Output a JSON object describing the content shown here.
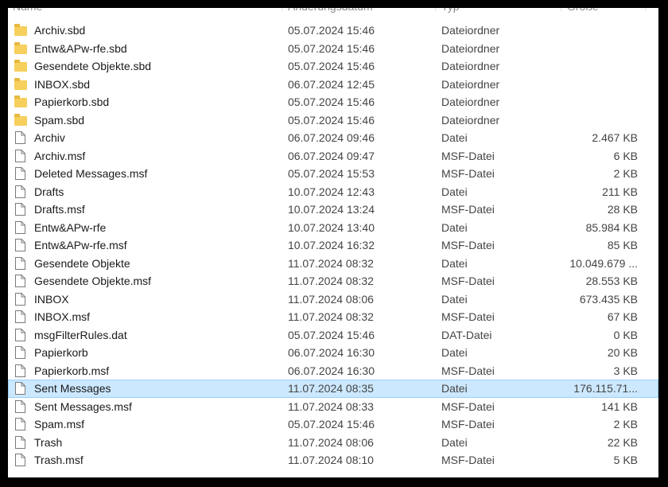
{
  "header": {
    "name": "Name",
    "date": "Änderungsdatum",
    "type": "Typ",
    "size": "Größe"
  },
  "files": [
    {
      "name": "Archiv.sbd",
      "date": "05.07.2024 15:46",
      "type": "Dateiordner",
      "size": "",
      "kind": "folder"
    },
    {
      "name": "Entw&APw-rfe.sbd",
      "date": "05.07.2024 15:46",
      "type": "Dateiordner",
      "size": "",
      "kind": "folder"
    },
    {
      "name": "Gesendete Objekte.sbd",
      "date": "05.07.2024 15:46",
      "type": "Dateiordner",
      "size": "",
      "kind": "folder"
    },
    {
      "name": "INBOX.sbd",
      "date": "06.07.2024 12:45",
      "type": "Dateiordner",
      "size": "",
      "kind": "folder"
    },
    {
      "name": "Papierkorb.sbd",
      "date": "05.07.2024 15:46",
      "type": "Dateiordner",
      "size": "",
      "kind": "folder"
    },
    {
      "name": "Spam.sbd",
      "date": "05.07.2024 15:46",
      "type": "Dateiordner",
      "size": "",
      "kind": "folder"
    },
    {
      "name": "Archiv",
      "date": "06.07.2024 09:46",
      "type": "Datei",
      "size": "2.467 KB",
      "kind": "file"
    },
    {
      "name": "Archiv.msf",
      "date": "06.07.2024 09:47",
      "type": "MSF-Datei",
      "size": "6 KB",
      "kind": "file"
    },
    {
      "name": "Deleted Messages.msf",
      "date": "05.07.2024 15:53",
      "type": "MSF-Datei",
      "size": "2 KB",
      "kind": "file"
    },
    {
      "name": "Drafts",
      "date": "10.07.2024 12:43",
      "type": "Datei",
      "size": "211 KB",
      "kind": "file"
    },
    {
      "name": "Drafts.msf",
      "date": "10.07.2024 13:24",
      "type": "MSF-Datei",
      "size": "28 KB",
      "kind": "file"
    },
    {
      "name": "Entw&APw-rfe",
      "date": "10.07.2024 13:40",
      "type": "Datei",
      "size": "85.984 KB",
      "kind": "file"
    },
    {
      "name": "Entw&APw-rfe.msf",
      "date": "10.07.2024 16:32",
      "type": "MSF-Datei",
      "size": "85 KB",
      "kind": "file"
    },
    {
      "name": "Gesendete Objekte",
      "date": "11.07.2024 08:32",
      "type": "Datei",
      "size": "10.049.679 ...",
      "kind": "file"
    },
    {
      "name": "Gesendete Objekte.msf",
      "date": "11.07.2024 08:32",
      "type": "MSF-Datei",
      "size": "28.553 KB",
      "kind": "file"
    },
    {
      "name": "INBOX",
      "date": "11.07.2024 08:06",
      "type": "Datei",
      "size": "673.435 KB",
      "kind": "file"
    },
    {
      "name": "INBOX.msf",
      "date": "11.07.2024 08:32",
      "type": "MSF-Datei",
      "size": "67 KB",
      "kind": "file"
    },
    {
      "name": "msgFilterRules.dat",
      "date": "05.07.2024 15:46",
      "type": "DAT-Datei",
      "size": "0 KB",
      "kind": "file"
    },
    {
      "name": "Papierkorb",
      "date": "06.07.2024 16:30",
      "type": "Datei",
      "size": "20 KB",
      "kind": "file"
    },
    {
      "name": "Papierkorb.msf",
      "date": "06.07.2024 16:30",
      "type": "MSF-Datei",
      "size": "3 KB",
      "kind": "file"
    },
    {
      "name": "Sent Messages",
      "date": "11.07.2024 08:35",
      "type": "Datei",
      "size": "176.115.71...",
      "kind": "file",
      "selected": true
    },
    {
      "name": "Sent Messages.msf",
      "date": "11.07.2024 08:33",
      "type": "MSF-Datei",
      "size": "141 KB",
      "kind": "file"
    },
    {
      "name": "Spam.msf",
      "date": "05.07.2024 15:46",
      "type": "MSF-Datei",
      "size": "2 KB",
      "kind": "file"
    },
    {
      "name": "Trash",
      "date": "11.07.2024 08:06",
      "type": "Datei",
      "size": "22 KB",
      "kind": "file"
    },
    {
      "name": "Trash.msf",
      "date": "11.07.2024 08:10",
      "type": "MSF-Datei",
      "size": "5 KB",
      "kind": "file"
    }
  ],
  "colors": {
    "folder": "#f6cf5c",
    "selection": "#cce8ff",
    "selection_border": "#99d1ff"
  }
}
